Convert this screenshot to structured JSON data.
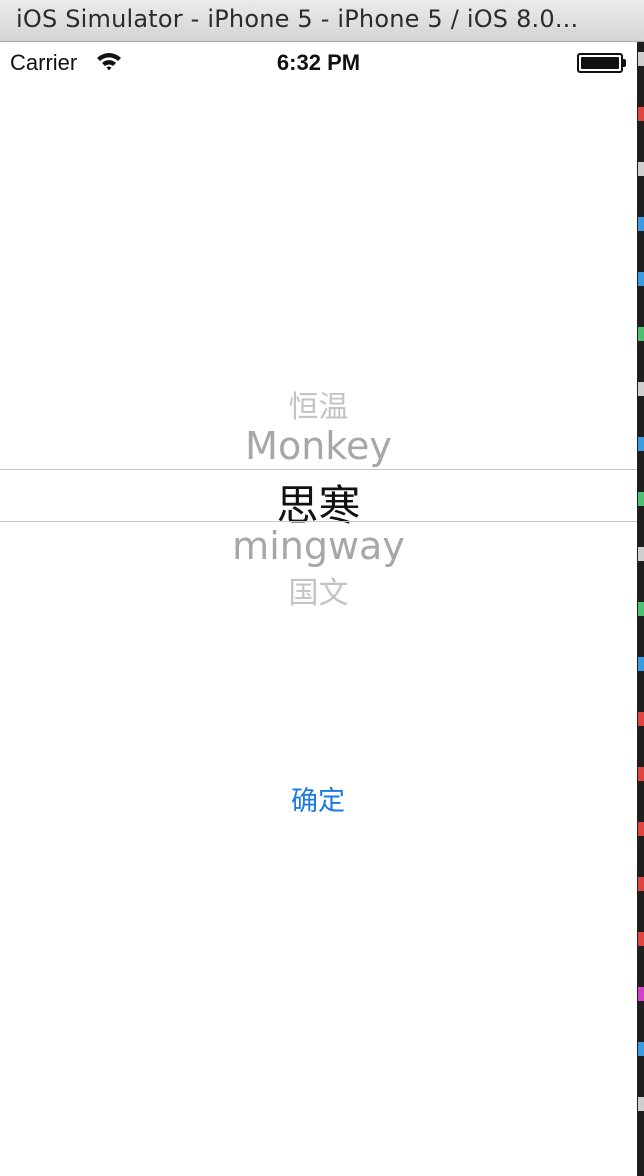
{
  "window": {
    "title": "iOS Simulator - iPhone 5 - iPhone 5 / iOS 8.0..."
  },
  "status_bar": {
    "carrier": "Carrier",
    "time": "6:32 PM",
    "wifi_icon": "wifi-icon",
    "battery_icon": "battery-icon",
    "battery_level": 1.0
  },
  "picker": {
    "rows": [
      "恒温",
      "Monkey",
      "思寒",
      "mingway",
      "国文"
    ],
    "selected_index": 2
  },
  "confirm_button": {
    "label": "确定"
  },
  "colors": {
    "tint": "#1a7ae6",
    "picker_selected_text": "#111111",
    "picker_dim_text": "#a7a7a7",
    "editor_background": "#1e1e1e"
  },
  "background_editor": {
    "marker_colors": [
      "#cfcfcf",
      "#e0443e",
      "#cfcfcf",
      "#3a9be0",
      "#3a9be0",
      "#4cc070",
      "#cfcfcf",
      "#3a9be0",
      "#4cc070",
      "#cfcfcf",
      "#4cc070",
      "#3a9be0",
      "#e0443e",
      "#e0443e",
      "#e0443e",
      "#e0443e",
      "#e0443e",
      "#d040c8",
      "#3a9be0",
      "#cfcfcf"
    ]
  }
}
